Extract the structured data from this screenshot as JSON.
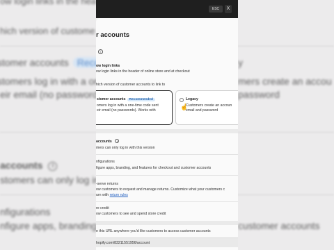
{
  "background": {
    "row1": "ow login links in the hea",
    "row2": "hich version of custome",
    "row3_left": "stomer accounts",
    "row3_badge": "Reco",
    "row3_right": "y",
    "row4_left": "stomers log in with a one",
    "row4_right": "mers create an accou",
    "row5_left": "eir email (no passwords",
    "row5_right": "password",
    "row6_left": "accounts",
    "row7_left": "stomers can only log in w",
    "row8_left": "nfigurations",
    "row9_left": "nfigure apps, branding,",
    "row9_right": "customer accounts",
    "row7_info": "i"
  },
  "dialog": {
    "esc_label": "ESC",
    "close_label": "X",
    "title": "r accounts",
    "info_icon": "i",
    "login_links_title": "ow login links",
    "login_links_desc": "ow login links in the header of online store and at checkout",
    "version_prompt": "hich version of customer accounts to link to",
    "option_new": {
      "title": "stomer accounts",
      "badge": "Recommended",
      "desc1": "omers log in with a one-time code sent",
      "desc2": "eir email (no passwords). Works with"
    },
    "option_legacy": {
      "title": "Legacy",
      "desc1": "Customers create an accoun",
      "desc2": "email and password"
    },
    "accounts_title": "accounts",
    "accounts_info": "i",
    "accounts_desc": "mers can only log in with this version",
    "config_title": "nfigurations",
    "config_desc": "figure apps, branding, and features for checkout and customer accounts",
    "returns_title": "-serve returns",
    "returns_desc1": "ow customers to request and manage returns. Customize what your customers c",
    "returns_desc2": "urn with",
    "returns_link": "return rules",
    "credit_title": "re credit",
    "credit_desc": "ow customers to see and spend store credit",
    "url_desc": "e this URL anywhere you'd like customers to access customer accounts",
    "url_value": "hopify.com/83211551956/account"
  }
}
